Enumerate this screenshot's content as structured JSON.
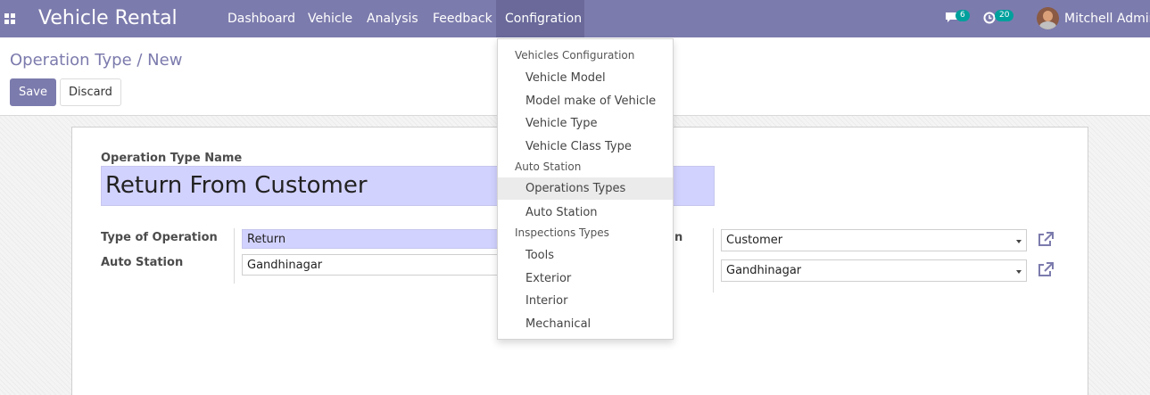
{
  "navbar": {
    "brand": "Vehicle Rental",
    "menu": [
      "Dashboard",
      "Vehicle",
      "Analysis",
      "Feedback",
      "Configration"
    ],
    "chat_count": "6",
    "activity_count": "20",
    "user": "Mitchell Admin",
    "bg_color": "#7c7bad"
  },
  "control_panel": {
    "breadcrumb": "Operation Type / New",
    "save_label": "Save",
    "discard_label": "Discard"
  },
  "form": {
    "name_label": "Operation Type Name",
    "name_value": "Return From Customer",
    "type_label": "Type of Operation",
    "type_value": "Return",
    "station_label": "Auto Station",
    "station_value": "Gandhinagar",
    "right_label_fragment": "n",
    "right_field_1": "Customer",
    "right_field_2": "Gandhinagar"
  },
  "dropdown": {
    "sections": [
      {
        "header": "Vehicles Configuration",
        "items": [
          "Vehicle Model",
          "Model make of Vehicle",
          "Vehicle Type",
          "Vehicle Class Type"
        ]
      },
      {
        "header": "Auto Station",
        "items": [
          "Operations Types",
          "Auto Station"
        ]
      },
      {
        "header": "Inspections Types",
        "items": [
          "Tools",
          "Exterior",
          "Interior",
          "Mechanical"
        ]
      }
    ],
    "active_item": "Operations Types"
  },
  "icons": {
    "apps": "apps-grid-icon",
    "chat": "chat-icon",
    "activity": "clock-icon",
    "external": "external-link-icon",
    "caret": "caret-down-icon"
  },
  "colors": {
    "primary": "#7c7bad",
    "badge": "#00a09d",
    "required_field": "#d2d2ff"
  }
}
